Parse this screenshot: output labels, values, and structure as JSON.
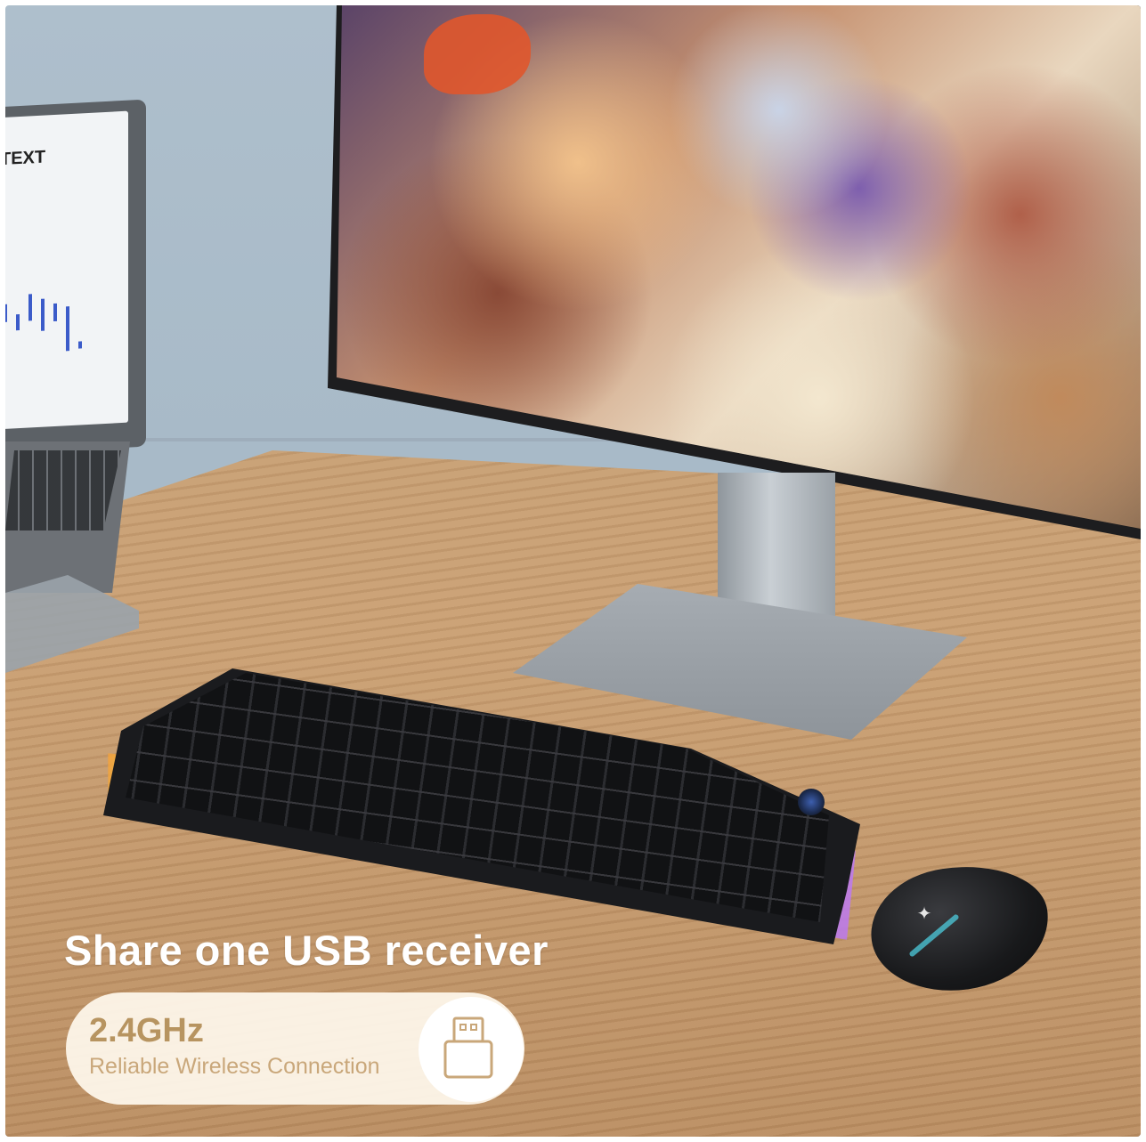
{
  "laptop": {
    "screen_heading": "TEXT"
  },
  "overlay": {
    "headline": "Share one USB receiver",
    "frequency": "2.4GHz",
    "subtitle": "Reliable Wireless Connection",
    "icon": "usb-receiver-icon"
  },
  "colors": {
    "headline": "#ffffff",
    "pill_background": "#fff8ee",
    "accent_gold": "#b79460"
  }
}
